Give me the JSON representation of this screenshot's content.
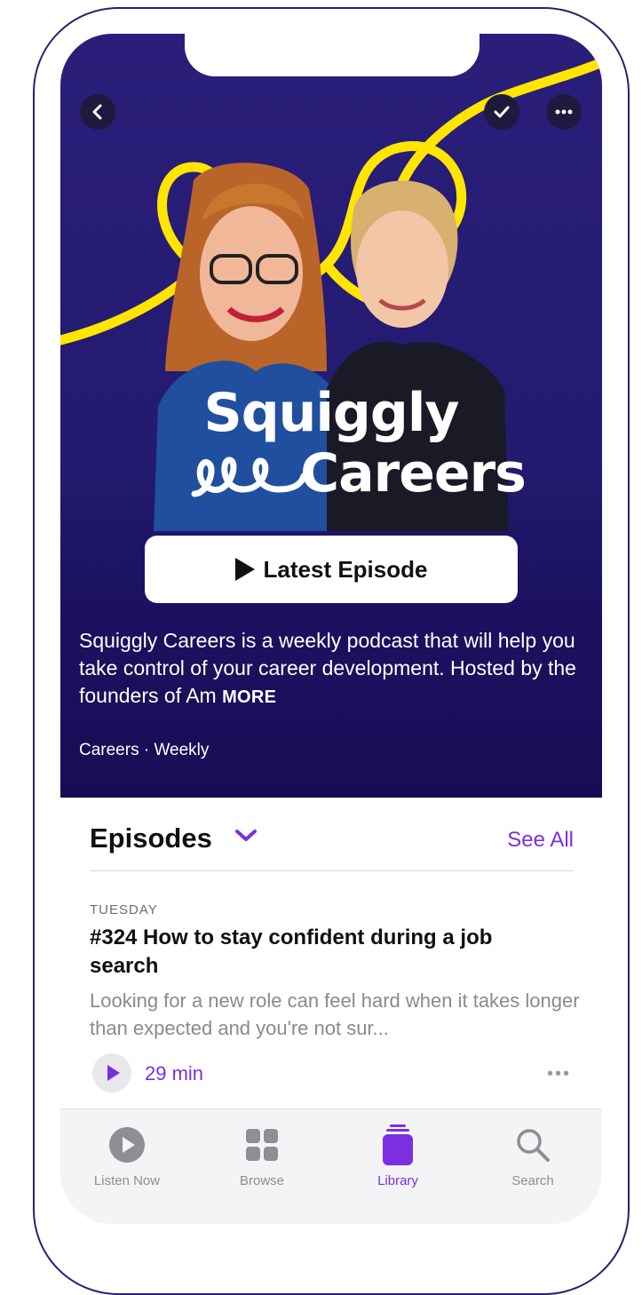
{
  "podcast": {
    "logo_line1": "Squiggly",
    "logo_line2": "Careers",
    "latest_button": "Latest Episode",
    "description": "Squiggly Careers is a weekly podcast that will help you take control of your career development. Hosted by the founders of Am",
    "more_label": "MORE",
    "meta": "Careers · Weekly"
  },
  "episodes": {
    "title": "Episodes",
    "see_all": "See All",
    "items": [
      {
        "day": "TUESDAY",
        "title": "#324 How to stay confident during a job search",
        "description": "Looking for a new role can feel hard when it takes longer than expected  and you're not sur...",
        "duration": "29 min"
      }
    ]
  },
  "tabs": [
    {
      "label": "Listen Now",
      "icon": "play-circle-icon"
    },
    {
      "label": "Browse",
      "icon": "grid-icon"
    },
    {
      "label": "Library",
      "icon": "library-stack-icon",
      "active": true
    },
    {
      "label": "Search",
      "icon": "magnifier-icon"
    }
  ],
  "colors": {
    "accent": "#7c2fe0",
    "hero_bg": "#241a70",
    "squiggle": "#ffe500"
  }
}
